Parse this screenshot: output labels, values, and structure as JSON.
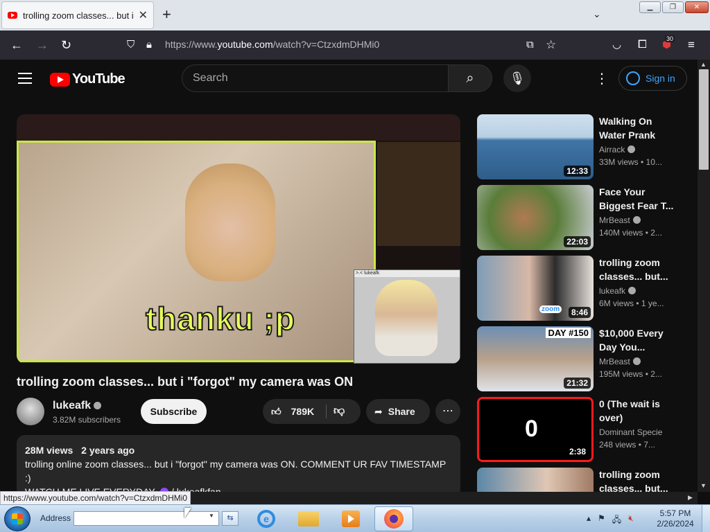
{
  "browser": {
    "tab_title": "trolling zoom classes... but i \"forgot\" my camera was ON",
    "url_prefix": "https://www.",
    "url_domain": "youtube.com",
    "url_path": "/watch?v=CtzxdmDHMi0",
    "extension_badge": "30",
    "status_url": "https://www.youtube.com/watch?v=CtzxdmDHMi0"
  },
  "header": {
    "logo_text": "YouTube",
    "search_placeholder": "Search",
    "signin_label": "Sign in"
  },
  "player": {
    "overlay_caption": "thanku ;p",
    "pip_label": ">.< lukeafk"
  },
  "video": {
    "title": "trolling zoom classes... but i \"forgot\" my camera was ON",
    "channel": "lukeafk",
    "subscribers": "3.82M subscribers",
    "subscribe_label": "Subscribe",
    "likes": "789K",
    "share_label": "Share",
    "views": "28M views",
    "age": "2 years ago",
    "description_line1": "trolling online zoom classes... but i \"forgot\" my camera was ON. COMMENT UR FAV TIMESTAMP :)",
    "description_line2_prefix": "WATCH ME LIVE EVERYDAY-",
    "description_link": "/ lukeafkfan"
  },
  "recommendations": [
    {
      "title": "Walking On Water Prank",
      "channel": "Airrack",
      "meta": "33M views  • 10...",
      "duration": "12:33"
    },
    {
      "title": "Face Your Biggest Fear T...",
      "channel": "MrBeast",
      "meta": "140M views  • 2...",
      "duration": "22:03"
    },
    {
      "title": "trolling zoom classes... but...",
      "channel": "lukeafk",
      "meta": "6M views  • 1 ye...",
      "duration": "8:46"
    },
    {
      "title": "$10,000 Every Day You...",
      "channel": "MrBeast",
      "meta": "195M views  • 2...",
      "duration": "21:32"
    },
    {
      "title": "0 (The wait is over)",
      "channel": "Dominant Specie",
      "meta": "248 views  • 7...",
      "duration": "2:38"
    },
    {
      "title": "trolling zoom classes... but...",
      "channel": "",
      "meta": "",
      "duration": ""
    }
  ],
  "thumb_text": {
    "zoom": "zoom",
    "day150": "DAY #150",
    "zero": "0"
  },
  "taskbar": {
    "address_label": "Address",
    "time": "5:57 PM",
    "date": "2/26/2024"
  }
}
